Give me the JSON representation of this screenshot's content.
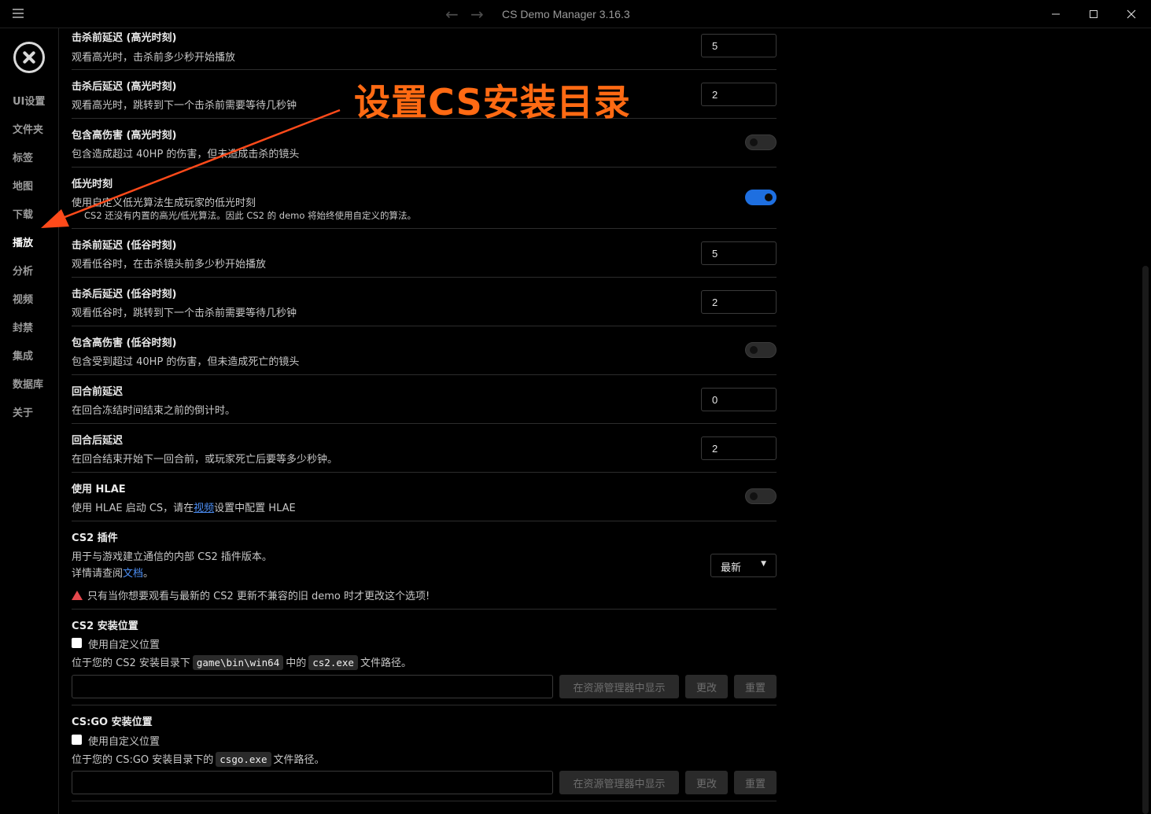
{
  "window": {
    "title": "CS Demo Manager 3.16.3"
  },
  "sidebar": {
    "items": [
      {
        "label": "UI设置"
      },
      {
        "label": "文件夹"
      },
      {
        "label": "标签"
      },
      {
        "label": "地图"
      },
      {
        "label": "下载"
      },
      {
        "label": "播放"
      },
      {
        "label": "分析"
      },
      {
        "label": "视频"
      },
      {
        "label": "封禁"
      },
      {
        "label": "集成"
      },
      {
        "label": "数据库"
      },
      {
        "label": "关于"
      }
    ],
    "active": "播放"
  },
  "settings": {
    "highlight_before": {
      "title": "击杀前延迟 (高光时刻)",
      "desc": "观看高光时，击杀前多少秒开始播放",
      "value": "5"
    },
    "highlight_after": {
      "title": "击杀后延迟 (高光时刻)",
      "desc": "观看高光时，跳转到下一个击杀前需要等待几秒钟",
      "value": "2"
    },
    "highlight_damage": {
      "title": "包含高伤害 (高光时刻)",
      "desc": "包含造成超过 40HP 的伤害，但未造成击杀的镜头",
      "enabled": false
    },
    "lowlight": {
      "title": "低光时刻",
      "desc": "使用自定义低光算法生成玩家的低光时刻",
      "note": "CS2 还没有内置的高光/低光算法。因此 CS2 的 demo 将始终使用自定义的算法。",
      "enabled": true
    },
    "lowlight_before": {
      "title": "击杀前延迟 (低谷时刻)",
      "desc": "观看低谷时，在击杀镜头前多少秒开始播放",
      "value": "5"
    },
    "lowlight_after": {
      "title": "击杀后延迟 (低谷时刻)",
      "desc": "观看低谷时，跳转到下一个击杀前需要等待几秒钟",
      "value": "2"
    },
    "lowlight_damage": {
      "title": "包含高伤害 (低谷时刻)",
      "desc": "包含受到超过 40HP 的伤害，但未造成死亡的镜头",
      "enabled": false
    },
    "round_before": {
      "title": "回合前延迟",
      "desc": "在回合冻结时间结束之前的倒计时。",
      "value": "0"
    },
    "round_after": {
      "title": "回合后延迟",
      "desc": "在回合结束开始下一回合前，或玩家死亡后要等多少秒钟。",
      "value": "2"
    },
    "hlae": {
      "title": "使用 HLAE",
      "desc_prefix": "使用 HLAE 启动 CS，请在",
      "desc_link": "视频",
      "desc_suffix": "设置中配置 HLAE",
      "enabled": false
    },
    "cs2_plugin": {
      "title": "CS2 插件",
      "desc": "用于与游戏建立通信的内部 CS2 插件版本。",
      "doc_prefix": "详情请查阅",
      "doc_link": "文档",
      "doc_suffix": "。",
      "warning": "只有当你想要观看与最新的 CS2 更新不兼容的旧 demo 时才更改这个选项!",
      "selected": "最新"
    },
    "cs2_location": {
      "title": "CS2 安装位置",
      "checkbox_label": "使用自定义位置",
      "desc_prefix": "位于您的 CS2 安装目录下",
      "code1": "game\\bin\\win64",
      "desc_mid": "中的",
      "code2": "cs2.exe",
      "desc_suffix": "文件路径。",
      "path_value": "",
      "btn_show": "在资源管理器中显示",
      "btn_change": "更改",
      "btn_reset": "重置"
    },
    "csgo_location": {
      "title": "CS:GO 安装位置",
      "checkbox_label": "使用自定义位置",
      "desc_prefix": "位于您的 CS:GO 安装目录下的",
      "code1": "csgo.exe",
      "desc_suffix": "文件路径。",
      "path_value": "",
      "btn_show": "在资源管理器中显示",
      "btn_change": "更改",
      "btn_reset": "重置"
    }
  },
  "annotation": {
    "text": "设置CS安装目录",
    "color": "#ff6a13"
  },
  "colors": {
    "accent": "#1e6fe0",
    "link": "#4d8ff5",
    "warning": "#e5484d"
  }
}
